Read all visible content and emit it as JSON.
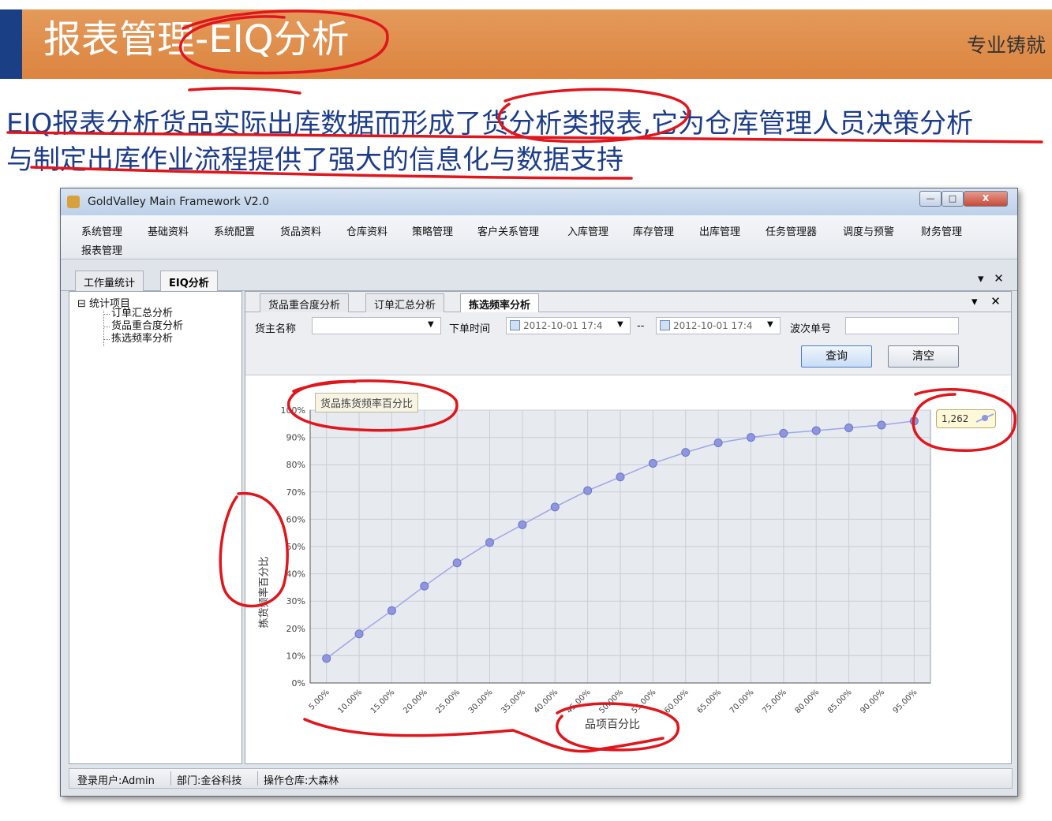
{
  "slide": {
    "title": "报表管理-EIQ分析",
    "slogan": "专业铸就",
    "intro_line1": "EIQ报表分析货品实际出库数据而形成了货分析类报表,它为仓库管理人员决策分析",
    "intro_line2": "与制定出库作业流程提供了强大的信息化与数据支持"
  },
  "window": {
    "title": "GoldValley Main Framework V2.0",
    "min_btn": "—",
    "max_btn": "□",
    "close_btn": "X"
  },
  "menu": {
    "items": [
      "系统管理",
      "基础资料",
      "系统配置",
      "货品资料",
      "仓库资料",
      "策略管理",
      "客户关系管理",
      "入库管理",
      "库存管理",
      "出库管理",
      "任务管理器",
      "调度与预警",
      "财务管理",
      "报表管理"
    ]
  },
  "doc_tabs": [
    "工作量统计",
    "EIQ分析"
  ],
  "tab_controls": "▾ ✕",
  "tree": {
    "root": "⊟ 统计项目",
    "children": [
      "订单汇总分析",
      "货品重合度分析",
      "拣选频率分析"
    ]
  },
  "inner_tabs": [
    "货品重合度分析",
    "订单汇总分析",
    "拣选频率分析"
  ],
  "inner_controls": "▾ ✕",
  "filters": {
    "owner_label": "货主名称",
    "owner_value": "",
    "order_time_label": "下单时间",
    "date_from": "2012-10-01 17:4",
    "range_sep": "--",
    "date_to": "2012-10-01 17:4",
    "wave_label": "波次单号",
    "wave_value": "",
    "dropdown": "▼",
    "query_btn": "查询",
    "clear_btn": "清空"
  },
  "chart_data": {
    "type": "line",
    "title": "货品拣货频率百分比",
    "xlabel": "品项百分比",
    "ylabel": "拣货频率百分比",
    "categories": [
      "5.00%",
      "10.00%",
      "15.00%",
      "20.00%",
      "25.00%",
      "30.00%",
      "35.00%",
      "40.00%",
      "45.00%",
      "50.00%",
      "55.00%",
      "60.00%",
      "65.00%",
      "70.00%",
      "75.00%",
      "80.00%",
      "85.00%",
      "90.00%",
      "95.00%"
    ],
    "values": [
      9,
      18,
      26.5,
      35.5,
      44,
      51.5,
      58,
      64.5,
      70.5,
      75.5,
      80.5,
      84.5,
      88,
      90,
      91.5,
      92.5,
      93.5,
      94.5,
      96
    ],
    "yticks": [
      "0%",
      "10%",
      "20%",
      "30%",
      "40%",
      "50%",
      "60%",
      "70%",
      "80%",
      "90%",
      "100%"
    ],
    "ylim": [
      0,
      100
    ],
    "grid": true,
    "tooltip": "1,262",
    "colors": {
      "line": "#9fa6e6",
      "marker": "#8e96e0",
      "plot_bg": "#e7eaef"
    }
  },
  "status": {
    "user": "登录用户:Admin",
    "dept": "部门:金谷科技",
    "warehouse": "操作仓库:大森林"
  },
  "annotation_color": "#e0161c"
}
